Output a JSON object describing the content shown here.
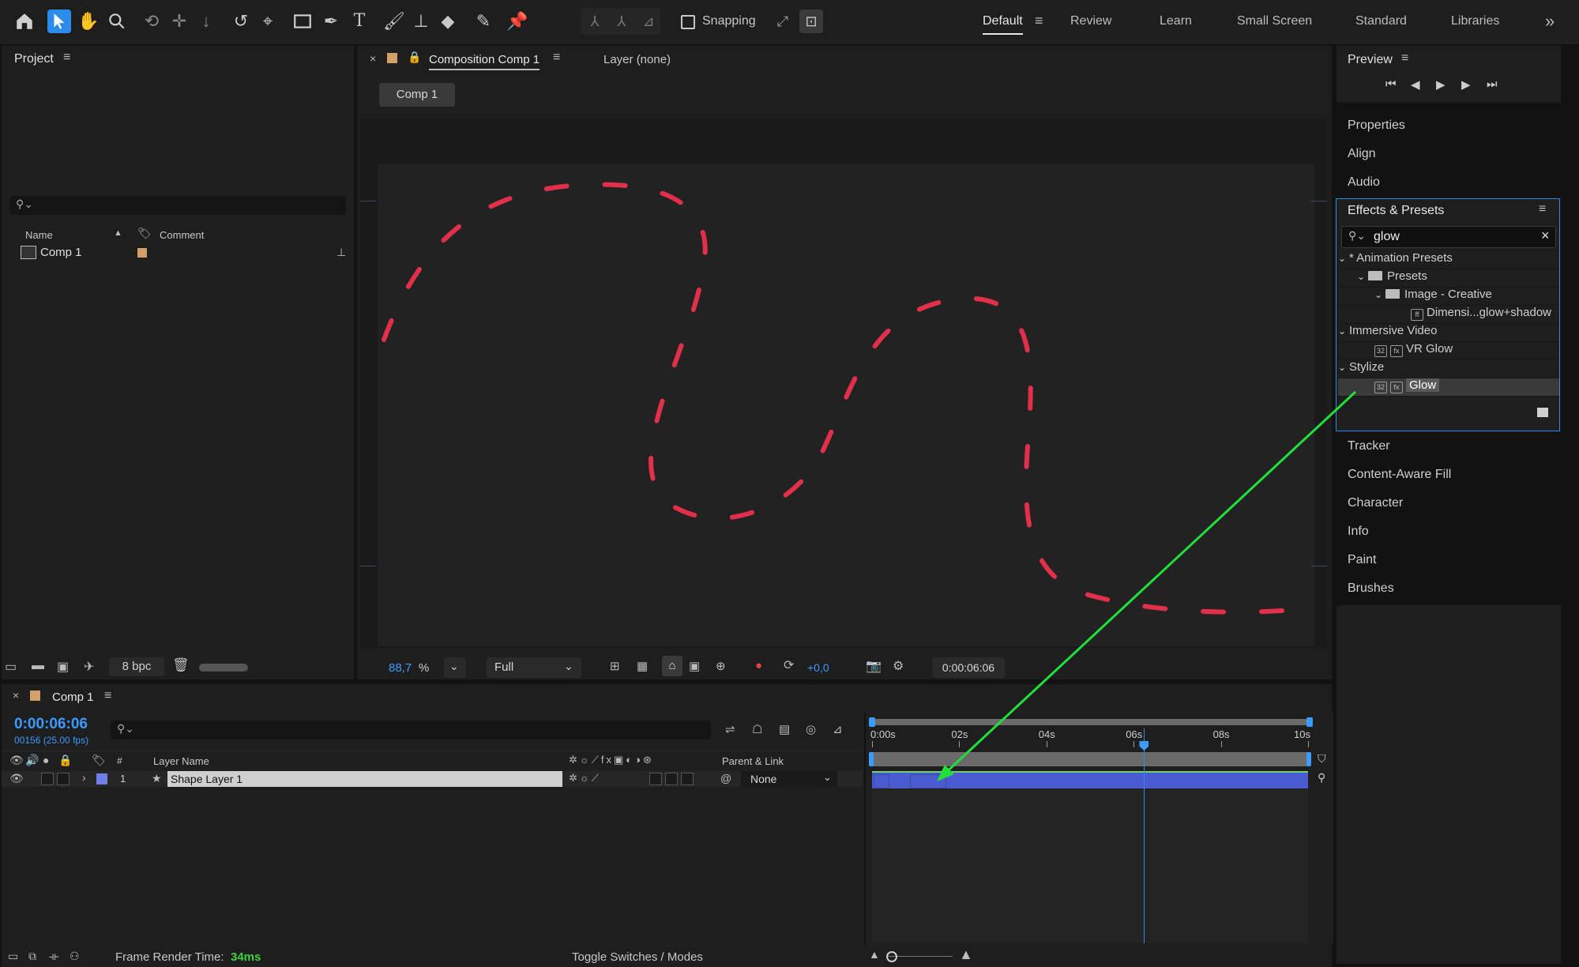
{
  "toolbar": {
    "tools": [
      "home-icon",
      "selection-arrow-icon",
      "hand-icon",
      "zoom-icon",
      "orbit-icon",
      "pan-icon",
      "dolly-icon",
      "rotate-icon",
      "anchor-icon",
      "rectangle-icon",
      "pen-icon",
      "text-icon",
      "brush-icon",
      "clone-stamp-icon",
      "eraser-icon",
      "roto-brush-icon",
      "puppet-pin-icon"
    ],
    "snapping_label": "Snapping",
    "workspaces": [
      "Default",
      "Review",
      "Learn",
      "Small Screen",
      "Standard",
      "Libraries"
    ],
    "active_workspace": "Default",
    "overflow": "»"
  },
  "project": {
    "title": "Project",
    "search_placeholder": "",
    "col_name": "Name",
    "col_comment": "Comment",
    "items": [
      {
        "name": "Comp 1"
      }
    ],
    "bpc": "8 bpc"
  },
  "composition": {
    "tab_label": "Composition Comp 1",
    "layer_tab": "Layer (none)",
    "breadcrumb": "Comp 1",
    "zoom_value": "88,7",
    "zoom_unit": "%",
    "resolution": "Full",
    "exposure": "+0,0",
    "timecode": "0:00:06:06"
  },
  "preview": {
    "title": "Preview"
  },
  "side_panels_top": [
    "Properties",
    "Align",
    "Audio"
  ],
  "effects": {
    "title": "Effects & Presets",
    "search_value": "glow",
    "tree": [
      {
        "label": "* Animation Presets",
        "level": 0,
        "type": "group"
      },
      {
        "label": "Presets",
        "level": 1,
        "type": "folder"
      },
      {
        "label": "Image - Creative",
        "level": 2,
        "type": "folder"
      },
      {
        "label": "Dimensi...glow+shadow",
        "level": 3,
        "type": "preset"
      },
      {
        "label": "Immersive Video",
        "level": 0,
        "type": "group"
      },
      {
        "label": "VR Glow",
        "level": 1,
        "type": "effect"
      },
      {
        "label": "Stylize",
        "level": 0,
        "type": "group"
      },
      {
        "label": "Glow",
        "level": 1,
        "type": "effect",
        "selected": true
      }
    ]
  },
  "side_panels_bottom": [
    "Tracker",
    "Content-Aware Fill",
    "Character",
    "Info",
    "Paint",
    "Brushes"
  ],
  "timeline": {
    "tab_label": "Comp 1",
    "timecode": "0:00:06:06",
    "frame_info": "00156 (25.00 fps)",
    "search_placeholder": "",
    "col_hash": "#",
    "col_layer_name": "Layer Name",
    "col_parent": "Parent & Link",
    "ruler": [
      {
        "label": "0:00s",
        "sec": 0
      },
      {
        "label": "02s",
        "sec": 2
      },
      {
        "label": "04s",
        "sec": 4
      },
      {
        "label": "06s",
        "sec": 6
      },
      {
        "label": "08s",
        "sec": 8
      },
      {
        "label": "10s",
        "sec": 10
      }
    ],
    "playhead_sec": 6.24,
    "duration_sec": 10,
    "layers": [
      {
        "index": "1",
        "name": "Shape Layer 1",
        "parent": "None",
        "color": "#6f7fe8"
      }
    ]
  },
  "status": {
    "render_label": "Frame Render Time:",
    "render_value": "34ms",
    "toggle_label": "Toggle Switches / Modes"
  },
  "colors": {
    "accent": "#2d8ceb",
    "shape_stroke": "#e2304a",
    "annotation_arrow": "#22e03c",
    "layer_bar": "#4a5ad0",
    "render_value": "#40d040"
  }
}
